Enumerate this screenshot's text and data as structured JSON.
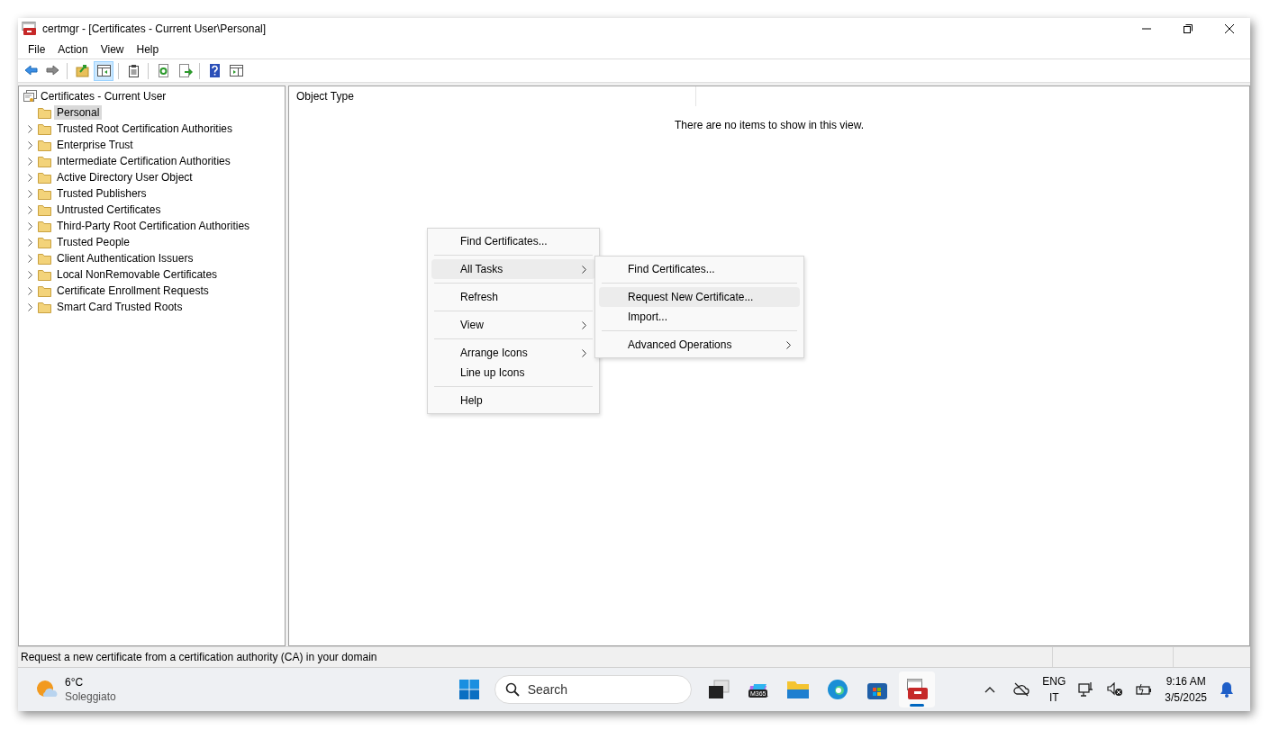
{
  "window": {
    "title": "certmgr - [Certificates - Current User\\Personal]"
  },
  "menu_bar": [
    "File",
    "Action",
    "View",
    "Help"
  ],
  "toolbar": [
    {
      "kind": "back",
      "selected": false
    },
    {
      "kind": "forward",
      "selected": false
    },
    {
      "kind": "sep"
    },
    {
      "kind": "up",
      "selected": false
    },
    {
      "kind": "tree",
      "selected": true
    },
    {
      "kind": "sep"
    },
    {
      "kind": "clipboard",
      "selected": false
    },
    {
      "kind": "sep"
    },
    {
      "kind": "refresh",
      "selected": false
    },
    {
      "kind": "export",
      "selected": false
    },
    {
      "kind": "sep"
    },
    {
      "kind": "help",
      "selected": false
    },
    {
      "kind": "console",
      "selected": false
    }
  ],
  "tree": {
    "label": "Certificates - Current User",
    "children": [
      {
        "label": "Personal",
        "selected": true,
        "expandable": false
      },
      {
        "label": "Trusted Root Certification Authorities",
        "selected": false,
        "expandable": true
      },
      {
        "label": "Enterprise Trust",
        "selected": false,
        "expandable": true
      },
      {
        "label": "Intermediate Certification Authorities",
        "selected": false,
        "expandable": true
      },
      {
        "label": "Active Directory User Object",
        "selected": false,
        "expandable": true
      },
      {
        "label": "Trusted Publishers",
        "selected": false,
        "expandable": true
      },
      {
        "label": "Untrusted Certificates",
        "selected": false,
        "expandable": true
      },
      {
        "label": "Third-Party Root Certification Authorities",
        "selected": false,
        "expandable": true
      },
      {
        "label": "Trusted People",
        "selected": false,
        "expandable": true
      },
      {
        "label": "Client Authentication Issuers",
        "selected": false,
        "expandable": true
      },
      {
        "label": "Local NonRemovable Certificates",
        "selected": false,
        "expandable": true
      },
      {
        "label": "Certificate Enrollment Requests",
        "selected": false,
        "expandable": true
      },
      {
        "label": "Smart Card Trusted Roots",
        "selected": false,
        "expandable": true
      }
    ]
  },
  "list_view": {
    "columns": [
      "Object Type"
    ],
    "empty_message": "There are no items to show in this view."
  },
  "context_menu": [
    {
      "kind": "item",
      "label": "Find Certificates...",
      "submenu": false,
      "selected": false
    },
    {
      "kind": "separator"
    },
    {
      "kind": "item",
      "label": "All Tasks",
      "submenu": true,
      "selected": true
    },
    {
      "kind": "separator"
    },
    {
      "kind": "item",
      "label": "Refresh",
      "submenu": false,
      "selected": false
    },
    {
      "kind": "separator"
    },
    {
      "kind": "item",
      "label": "View",
      "submenu": true,
      "selected": false
    },
    {
      "kind": "separator"
    },
    {
      "kind": "item",
      "label": "Arrange Icons",
      "submenu": true,
      "selected": false
    },
    {
      "kind": "item",
      "label": "Line up Icons",
      "submenu": false,
      "selected": false
    },
    {
      "kind": "separator"
    },
    {
      "kind": "item",
      "label": "Help",
      "submenu": false,
      "selected": false
    }
  ],
  "submenu": [
    {
      "kind": "item",
      "label": "Find Certificates...",
      "submenu": false,
      "selected": false
    },
    {
      "kind": "separator"
    },
    {
      "kind": "item",
      "label": "Request New Certificate...",
      "submenu": false,
      "selected": true
    },
    {
      "kind": "item",
      "label": "Import...",
      "submenu": false,
      "selected": false
    },
    {
      "kind": "separator"
    },
    {
      "kind": "item",
      "label": "Advanced Operations",
      "submenu": true,
      "selected": false
    }
  ],
  "status_bar": {
    "text": "Request a new certificate from a certification authority (CA) in your domain"
  },
  "taskbar": {
    "weather": {
      "temperature": "6°C",
      "condition": "Soleggiato"
    },
    "search": {
      "placeholder": "Search"
    },
    "apps": [
      {
        "kind": "taskview",
        "selected": false
      },
      {
        "kind": "copilot",
        "label": "M365",
        "selected": false
      },
      {
        "kind": "files",
        "selected": false
      },
      {
        "kind": "browser",
        "selected": false
      },
      {
        "kind": "store",
        "selected": false
      },
      {
        "kind": "certmgr",
        "selected": true
      }
    ],
    "language": {
      "code": "ENG",
      "layout": "IT"
    },
    "time": "9:16 AM",
    "date": "3/5/2025"
  }
}
